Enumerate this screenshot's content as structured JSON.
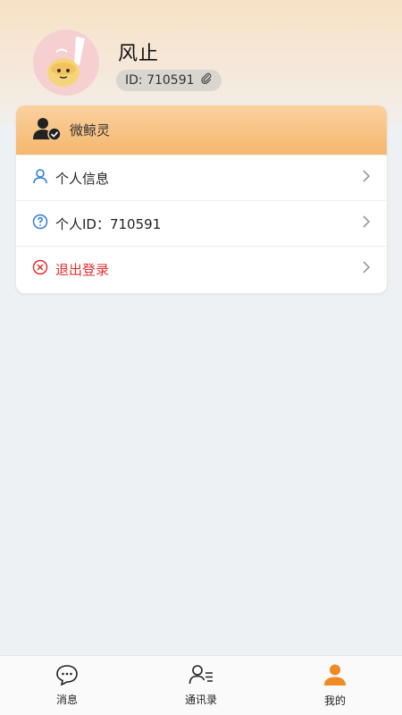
{
  "profile": {
    "name": "风止",
    "id_text": "ID: 710591"
  },
  "menu": {
    "header_label": "微鲸灵",
    "items": [
      {
        "label": "个人信息",
        "icon": "person-icon"
      },
      {
        "label": "个人ID：710591",
        "icon": "question-circle-icon"
      },
      {
        "label": "退出登录",
        "icon": "close-circle-icon"
      }
    ]
  },
  "tabs": [
    {
      "label": "消息",
      "icon": "chat-bubble-icon"
    },
    {
      "label": "通讯录",
      "icon": "contacts-icon"
    },
    {
      "label": "我的",
      "icon": "profile-icon",
      "active": true
    }
  ],
  "colors": {
    "accent": "#f08a24",
    "logout": "#e0302d",
    "blue_icon": "#2f7ed8"
  }
}
